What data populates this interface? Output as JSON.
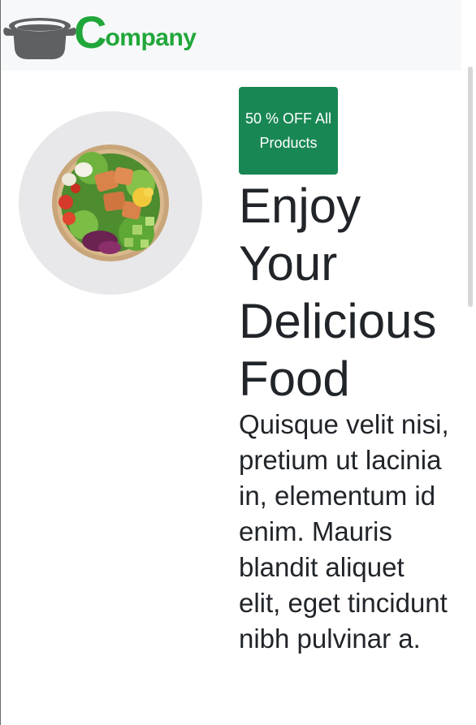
{
  "header": {
    "logo_icon": "cooking-pot-icon",
    "brand_initial": "C",
    "brand_rest": "ompany",
    "brand_color": "#20a73a",
    "background": "#f7f8f9"
  },
  "hero": {
    "image": "salad-bowl-image",
    "badge": "50 % OFF All Products",
    "badge_color": "#198754",
    "title": "Enjoy Your Delicious Food",
    "text": "Quisque velit nisi, pretium ut lacinia in, elementum id enim. Mauris blandit aliquet elit, eget tincidunt nibh pulvinar a."
  }
}
